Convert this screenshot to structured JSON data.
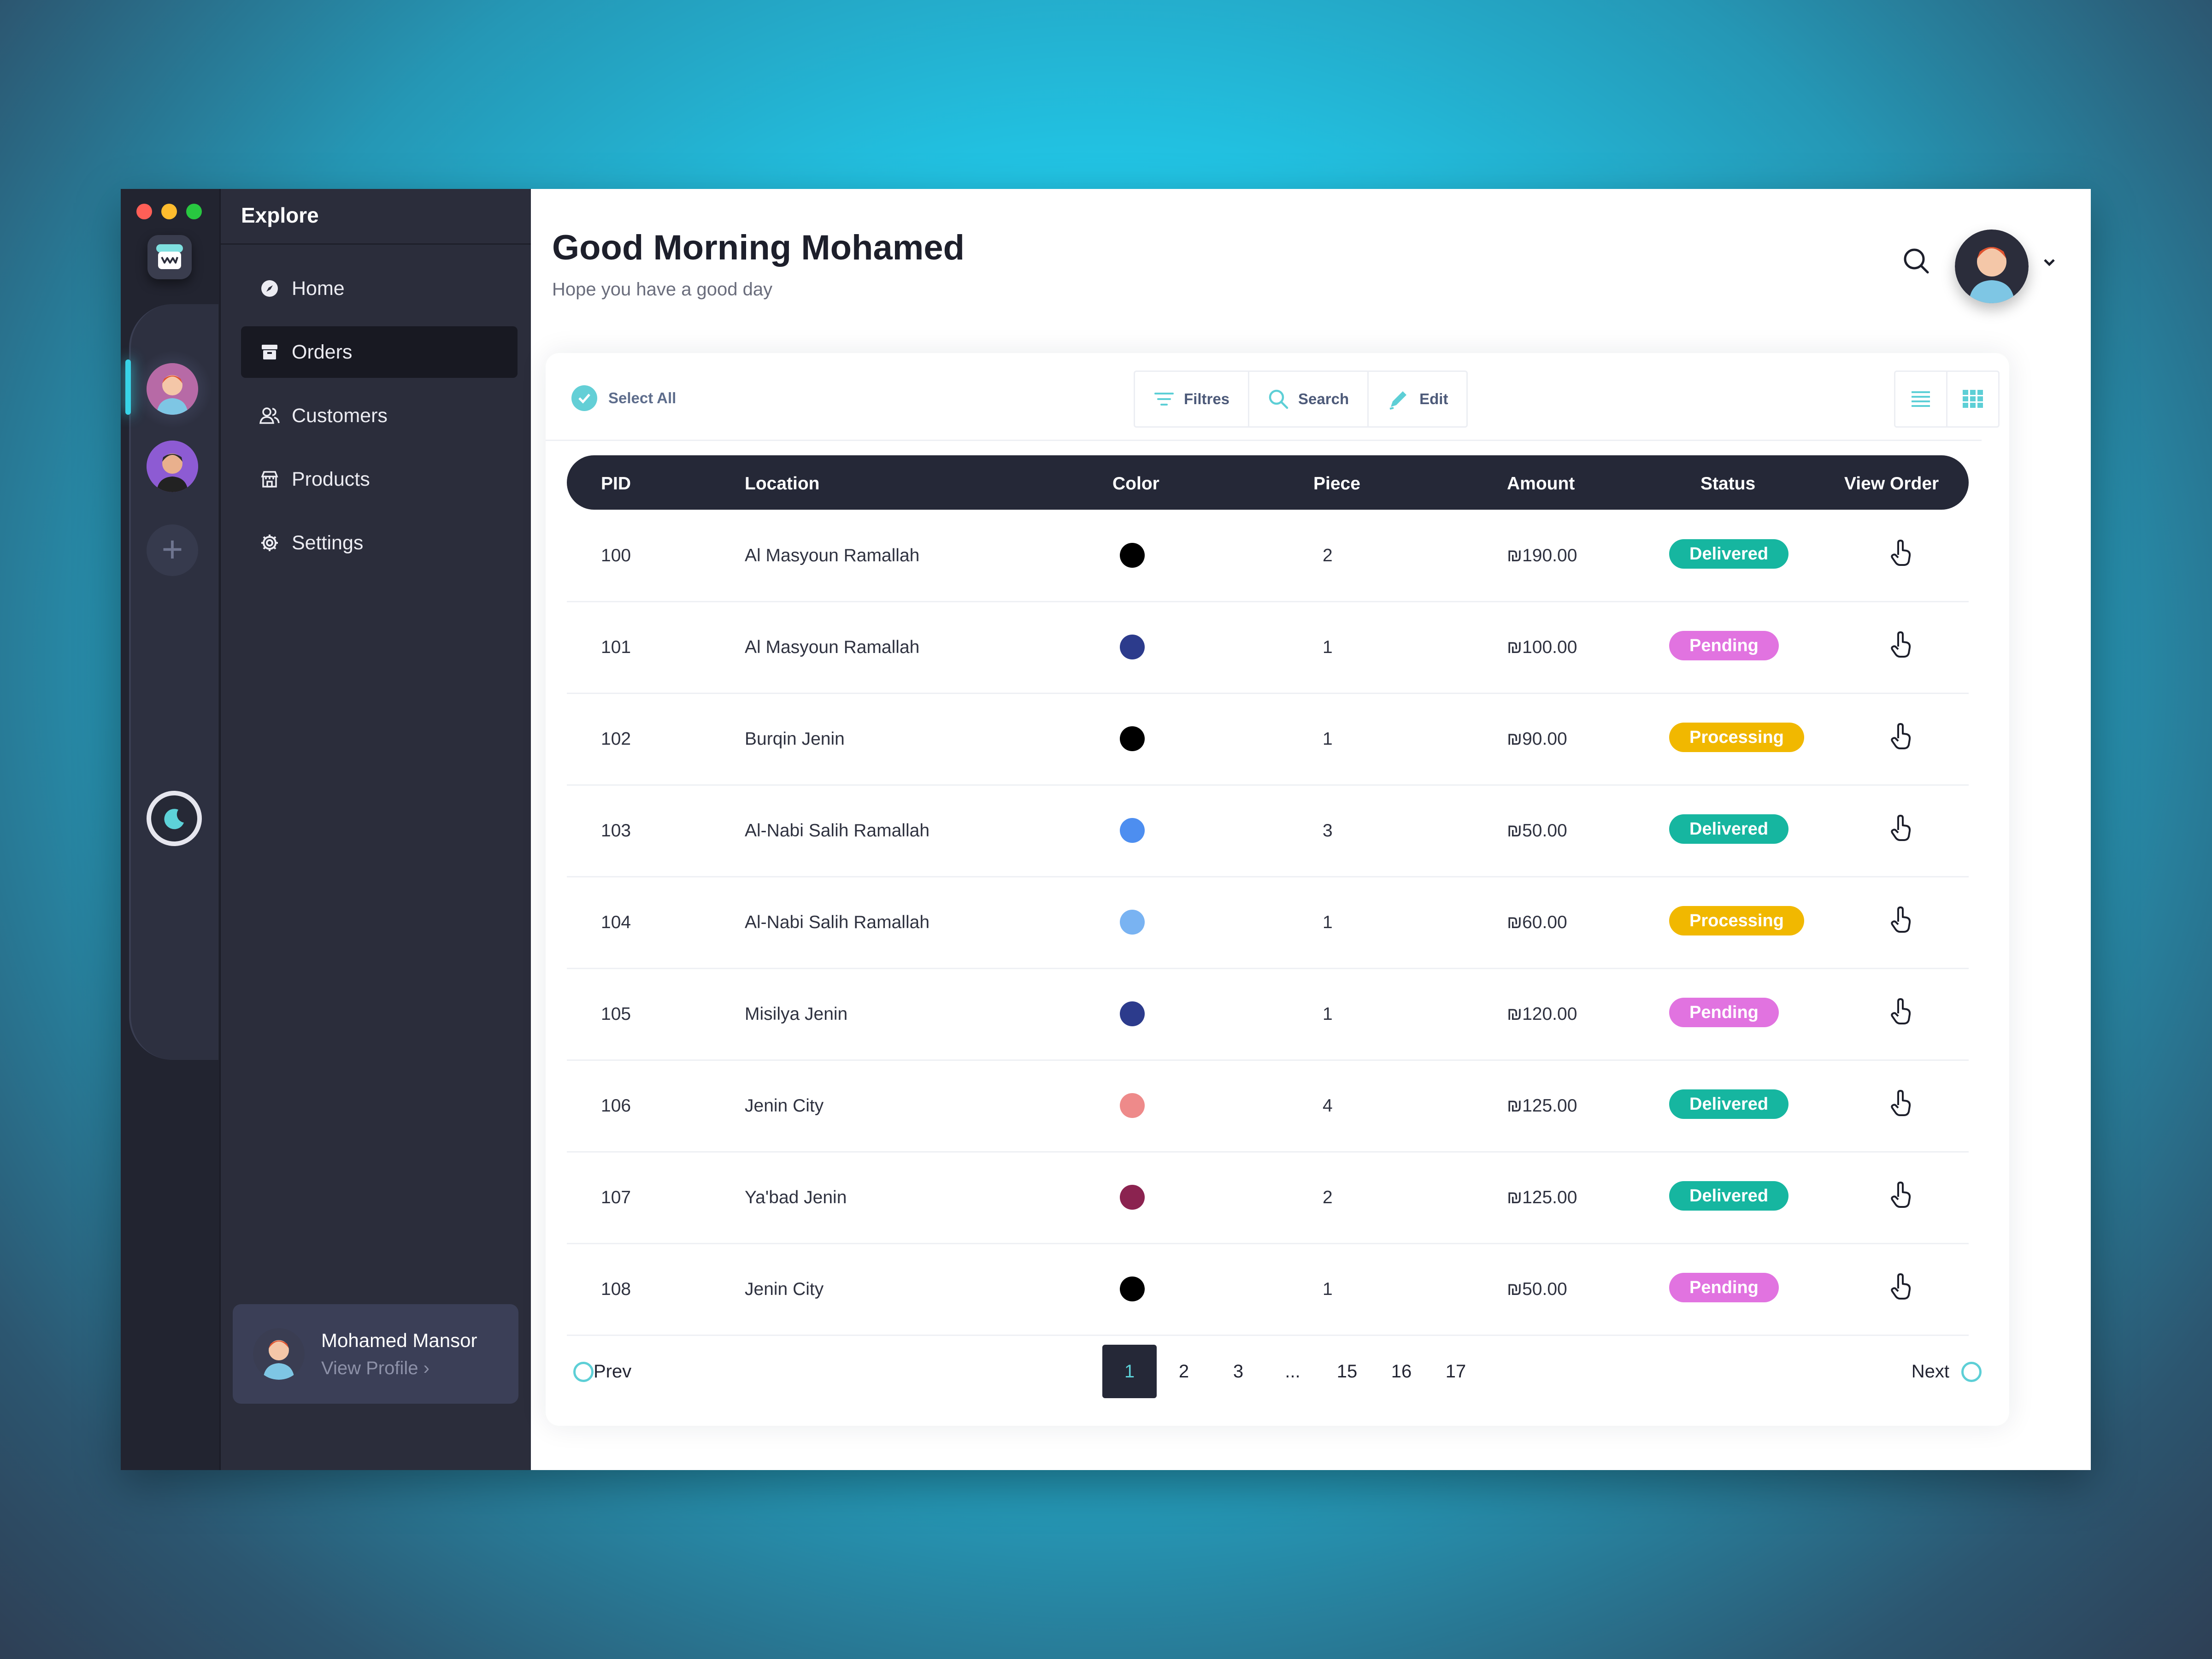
{
  "colors": {
    "accent": "#5dcfd6",
    "delivered": "#16b6a0",
    "pending": "#e173e0",
    "processing": "#f1b800",
    "dark": "#252837"
  },
  "sidebar": {
    "title": "Explore",
    "items": [
      {
        "label": "Home",
        "icon": "compass-icon"
      },
      {
        "label": "Orders",
        "icon": "archive-icon",
        "active": true
      },
      {
        "label": "Customers",
        "icon": "users-icon"
      },
      {
        "label": "Products",
        "icon": "store-icon"
      },
      {
        "label": "Settings",
        "icon": "gear-icon"
      }
    ],
    "profile": {
      "name": "Mohamed Mansor",
      "link": "View Profile"
    }
  },
  "header": {
    "greeting": "Good Morning Mohamed",
    "subtitle": "Hope you have a good day"
  },
  "toolbar": {
    "select_all": "Select All",
    "filters": "Filtres",
    "search": "Search",
    "edit": "Edit"
  },
  "table": {
    "columns": [
      "PID",
      "Location",
      "Color",
      "Piece",
      "Amount",
      "Status",
      "View Order"
    ],
    "rows": [
      {
        "pid": "100",
        "location": "Al Masyoun Ramallah",
        "color": "#000000",
        "piece": "2",
        "amount": "₪190.00",
        "status": "Delivered"
      },
      {
        "pid": "101",
        "location": "Al Masyoun Ramallah",
        "color": "#2c3b8c",
        "piece": "1",
        "amount": "₪100.00",
        "status": "Pending"
      },
      {
        "pid": "102",
        "location": "Burqin Jenin",
        "color": "#000000",
        "piece": "1",
        "amount": "₪90.00",
        "status": "Processing"
      },
      {
        "pid": "103",
        "location": "Al-Nabi Salih Ramallah",
        "color": "#4d8ef0",
        "piece": "3",
        "amount": "₪50.00",
        "status": "Delivered"
      },
      {
        "pid": "104",
        "location": "Al-Nabi Salih Ramallah",
        "color": "#79b3f2",
        "piece": "1",
        "amount": "₪60.00",
        "status": "Processing"
      },
      {
        "pid": "105",
        "location": "Misilya Jenin",
        "color": "#2c3b8c",
        "piece": "1",
        "amount": "₪120.00",
        "status": "Pending"
      },
      {
        "pid": "106",
        "location": "Jenin City",
        "color": "#ee8a8a",
        "piece": "4",
        "amount": "₪125.00",
        "status": "Delivered"
      },
      {
        "pid": "107",
        "location": "Ya'bad Jenin",
        "color": "#8b2350",
        "piece": "2",
        "amount": "₪125.00",
        "status": "Delivered"
      },
      {
        "pid": "108",
        "location": "Jenin City",
        "color": "#000000",
        "piece": "1",
        "amount": "₪50.00",
        "status": "Pending"
      }
    ]
  },
  "pagination": {
    "prev": "Prev",
    "next": "Next",
    "pages": [
      "1",
      "2",
      "3",
      "...",
      "15",
      "16",
      "17"
    ],
    "current": "1"
  }
}
